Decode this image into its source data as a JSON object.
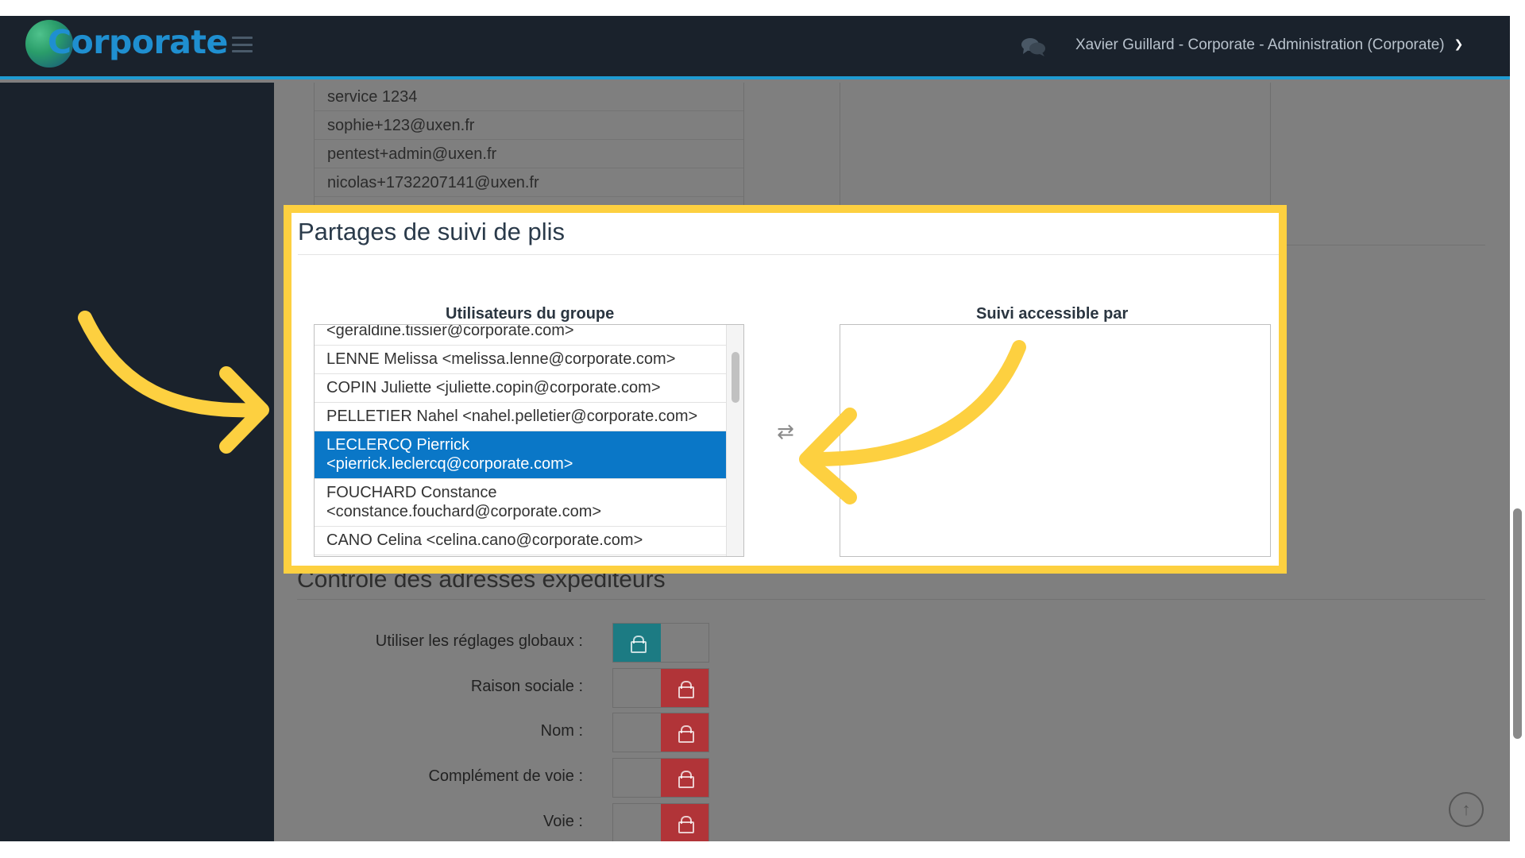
{
  "app": {
    "logo_text": "Corporate",
    "user_label": "Xavier Guillard - Corporate - Administration (Corporate)"
  },
  "top_list": {
    "items": [
      "service 1234",
      "sophie+123@uxen.fr",
      "pentest+admin@uxen.fr",
      "nicolas+1732207141@uxen.fr"
    ]
  },
  "sharing": {
    "title": "Partages de suivi de plis",
    "group_users_label": "Utilisateurs du groupe",
    "access_label": "Suivi accessible par",
    "users": [
      {
        "name": "<geraldine.tissier@corporate.com>"
      },
      {
        "name": "LENNE Melissa <melissa.lenne@corporate.com>"
      },
      {
        "name": "COPIN Juliette <juliette.copin@corporate.com>"
      },
      {
        "name": "PELLETIER Nahel <nahel.pelletier@corporate.com>"
      },
      {
        "name": "LECLERCQ Pierrick <pierrick.leclercq@corporate.com>",
        "selected": true
      },
      {
        "name": "FOUCHARD Constance <constance.fouchard@corporate.com>"
      },
      {
        "name": "CANO Celina <celina.cano@corporate.com>"
      }
    ],
    "transfer_icon": "⇄"
  },
  "sender_control": {
    "title": "Contrôle des adresses expéditeurs",
    "rows": [
      {
        "label": "Utiliser les réglages globaux :",
        "state": "unlocked"
      },
      {
        "label": "Raison sociale :",
        "state": "locked"
      },
      {
        "label": "Nom :",
        "state": "locked"
      },
      {
        "label": "Complément de voie :",
        "state": "locked"
      },
      {
        "label": "Voie :",
        "state": "locked"
      }
    ]
  },
  "icons": {
    "chat": "chat-icon",
    "chevron": "chevron-down-icon",
    "up": "arrow-up-icon",
    "lock": "lock-icon"
  },
  "colors": {
    "navbar": "#1a222c",
    "accent_blue": "#1f9bd1",
    "selected": "#0a77c7",
    "highlight": "#fdd040",
    "teal": "#1c7b83",
    "red": "#b13438"
  }
}
